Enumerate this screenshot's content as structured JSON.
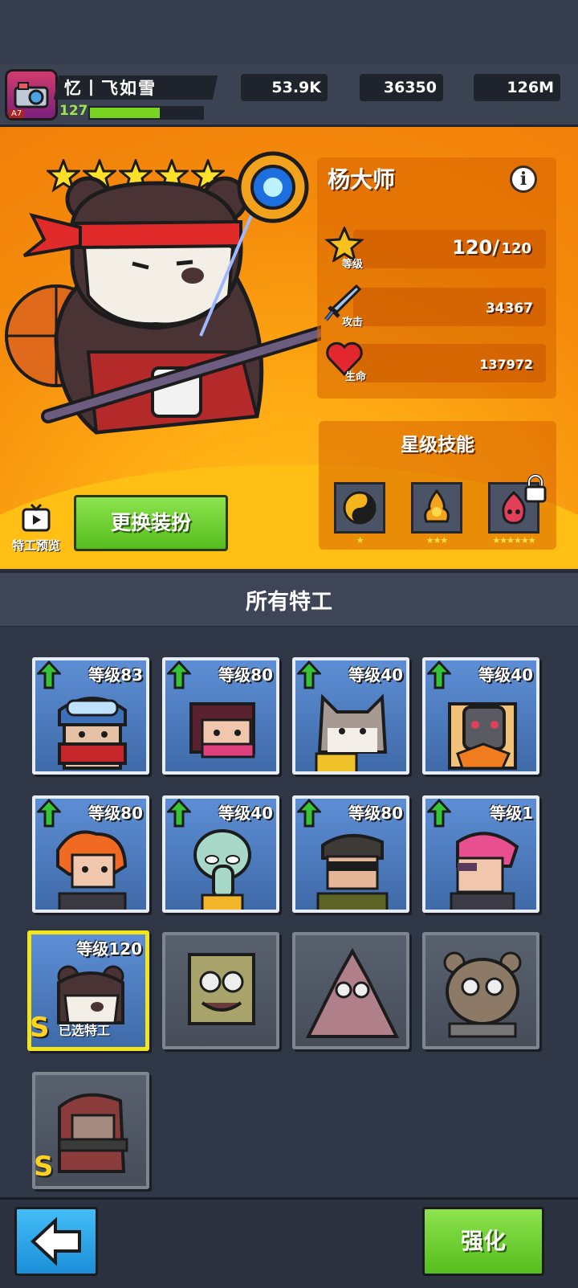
{
  "player": {
    "name": "忆丨飞如雪",
    "level": "127",
    "avatar_badge": "A7",
    "xp_fraction": 0.62
  },
  "currencies": [
    {
      "name": "droplet-icon",
      "value": "53.9K"
    },
    {
      "name": "gem-icon",
      "value": "36350"
    },
    {
      "name": "gold-coin-icon",
      "value": "126M"
    }
  ],
  "hero": {
    "name": "杨大师",
    "star_count": 5,
    "level_label": "等级",
    "level_value": "120/",
    "level_max": "120",
    "attack_label": "攻击",
    "attack_value": "34367",
    "hp_label": "生命",
    "hp_value": "137972"
  },
  "skills": {
    "title": "星级技能",
    "items": [
      {
        "icon": "yin-yang-icon",
        "stars": "★",
        "locked": false
      },
      {
        "icon": "fire-figure-icon",
        "stars": "★★★",
        "locked": false
      },
      {
        "icon": "fire-demon-icon",
        "stars": "★★★★★★",
        "locked": true
      }
    ]
  },
  "buttons": {
    "preview_label": "特工预览",
    "change_outfit": "更换装扮",
    "upgrade": "强化"
  },
  "agents_section": {
    "title": "所有特工",
    "cards": [
      {
        "level": "等级83",
        "upgrade": true
      },
      {
        "level": "等级80",
        "upgrade": true
      },
      {
        "level": "等级40",
        "upgrade": true
      },
      {
        "level": "等级40",
        "upgrade": true
      },
      {
        "level": "等级80",
        "upgrade": true
      },
      {
        "level": "等级40",
        "upgrade": true
      },
      {
        "level": "等级80",
        "upgrade": true
      },
      {
        "level": "等级1",
        "upgrade": true
      },
      {
        "level": "等级120",
        "upgrade": false,
        "selected": true,
        "selected_label": "已选特工",
        "rank": "S"
      },
      {
        "level": "",
        "locked": true
      },
      {
        "level": "",
        "locked": true
      },
      {
        "level": "",
        "locked": true
      },
      {
        "level": "",
        "locked": true,
        "rank": "S"
      }
    ]
  },
  "colors": {
    "accent_orange": "#f58c0c",
    "accent_green": "#6fd52c",
    "accent_blue": "#2aa6ea",
    "selected_border": "#f3e51c"
  }
}
